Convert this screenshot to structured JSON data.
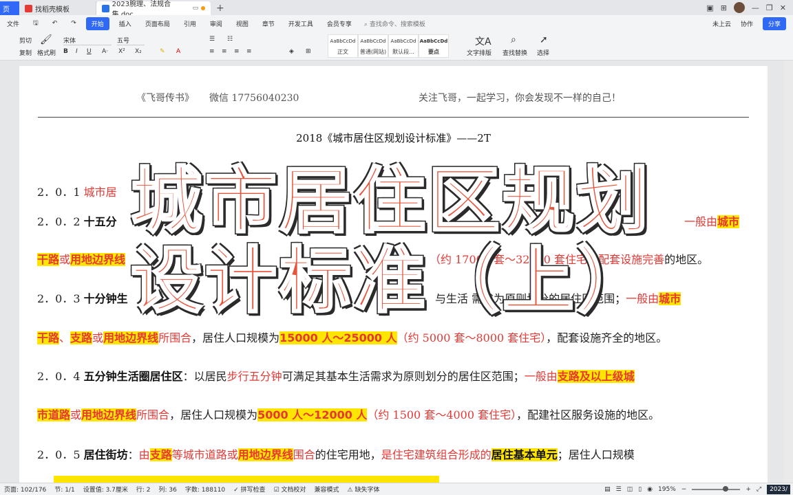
{
  "tabs": [
    {
      "label": "页"
    },
    {
      "label": "找稻壳模板"
    },
    {
      "label": "2023腕理、法规合集.doc"
    }
  ],
  "new_tab": "+",
  "menu": {
    "file": "文件",
    "items": [
      "开始",
      "插入",
      "页面布局",
      "引用",
      "审阅",
      "视图",
      "章节",
      "开发工具",
      "会员专享"
    ],
    "search": "查找命令、搜索模板",
    "cloud": "未上云",
    "collab": "协作",
    "share": "分享"
  },
  "ribbon": {
    "cut": "剪切",
    "copy": "复制",
    "format_painter": "格式刷",
    "font": "宋体",
    "size": "五号",
    "styles": [
      {
        "preview": "AaBbCcDd",
        "label": "正文"
      },
      {
        "preview": "AaBbCcDd",
        "label": "普通(网站)"
      },
      {
        "preview": "AaBbCcDd",
        "label": "默认段..."
      },
      {
        "preview": "AaBbCcDd",
        "label": "要点"
      }
    ],
    "text_layout": "文字排版",
    "find_replace": "查找替换",
    "select": "选择"
  },
  "document": {
    "header_left": "《飞哥传书》",
    "header_wechat": "微信  17756040230",
    "header_right": "关注飞哥，一起学习，你会发现不一样的自己！",
    "title": "2018《城市居住区规划设计标准》——2T",
    "p201": {
      "num": "2．0．1",
      "text": "城市居"
    },
    "p202": {
      "num": "2．0．2",
      "term": "十五分",
      "mid": "一般由",
      "hl1": "城市",
      "hl2": "干路",
      "or": "或",
      "hl3": "用地边界线",
      "tail_r": "（约 17000 套～32000 套住宅）",
      "tail": "配套设施完善",
      "end": "的地区。"
    },
    "p203": {
      "num": "2．0．3",
      "term": "十分钟生",
      "mid": "与生活",
      "mid2": "需求为原则划分的居住区范围；",
      "r1": "一般由",
      "hl1": "城市",
      "hl2": "干路",
      "sep": "、",
      "hl3": "支路",
      "or": "或",
      "hl4": "用地边界线",
      "r2": "所围合",
      "t1": "，居住人口规模为",
      "hl5": "15000 人～25000 人",
      "r3": "（约 5000 套～8000 套住宅）",
      "t2": "，配套设施齐全的地区。"
    },
    "p204": {
      "num": "2．0．4",
      "term": "五分钟生活圈居住区",
      "t1": "：以居民",
      "r1": "步行五分钟",
      "t2": "可满足其基本生活需求为原则划分的居住区范围；",
      "r2": "一般由",
      "hl1": "支路及以上级城",
      "hl2": "市道路",
      "or": "或",
      "hl3": "用地边界线",
      "r3": "所围合",
      "t3": "，居住人口规模为",
      "hl4": "5000 人～12000 人",
      "r4": "（约 1500 套～4000 套住宅）",
      "t4": "，配建社区服务设施的地区。"
    },
    "p205": {
      "num": "2．0．5",
      "term": "居住街坊",
      "t1": "：",
      "r1": "由",
      "hl1": "支路",
      "r2": "等城市道路或",
      "hl2": "用地边界线",
      "r3": "围合",
      "t2": "的住宅用地，",
      "r4": "是住宅建筑组合形成的",
      "hl3": "居住基本单元",
      "t3": "；居住人口规模"
    }
  },
  "overlay": {
    "line1": "城市居住区规划",
    "line2": "设计标准（上）"
  },
  "status": {
    "page_count": "页面: 102/176",
    "section": "节: 1/1",
    "setting": "设置值: 3.7厘米",
    "row": "行: 2",
    "col": "列: 36",
    "words": "字数: 188110",
    "spell": "拼写检查",
    "proof": "文档校对",
    "compat": "兼容模式",
    "missing_font": "缺失字体",
    "zoom": "195%",
    "time": "2023/"
  },
  "zoom_fraction": 0.72
}
